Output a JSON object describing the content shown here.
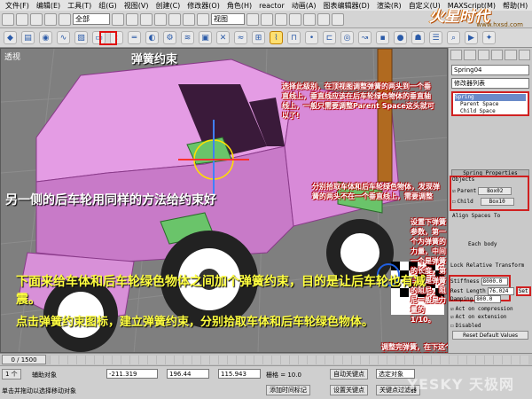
{
  "menubar": {
    "items": [
      "文件(F)",
      "编辑(E)",
      "工具(T)",
      "组(G)",
      "视图(V)",
      "创建(C)",
      "修改器(O)",
      "角色(H)",
      "reactor",
      "动画(A)",
      "图表编辑器(D)",
      "渲染(R)",
      "自定义(U)",
      "MAXScript(M)",
      "帮助(H)"
    ]
  },
  "toolbar1": {
    "selection_filter": "全部",
    "view_select": "视图"
  },
  "logo": {
    "main": "火星时代",
    "sub": "www.hxsd.com"
  },
  "viewport": {
    "label": "透视"
  },
  "annotations": {
    "spring_constraint": "弹簧约束",
    "select_spring": "选择此级别，在顶视图调整弹簧的两头到一个垂直线上，垂直线应该在后车轮绿色物体的垂直轴线上，一般只需要调整Parent Space这头就可以了!",
    "other_side": "另一侧的后车轮用同样的方法给约束好",
    "pick_objects": "分别拾取车体和后车轮绿色物体，发现弹簧的两头不在一个垂直线上，需要调整",
    "spring_params": "设置下弹簧参数，第一个为弹簧的力量，中间一个是弹簧的长度，第三个是弹簧的阻尼，阻尼一般是力量的1/10。",
    "instruction_1": "下面来给车体和后车轮绿色物体之间加个弹簧约束，目的是让后车轮也有减震。",
    "instruction_2": "点击弹簧约束图标，建立弹簧约束，分别拾取车体和后车轮绿色物体。",
    "after_adjust": "调整完弹簧，在下这个，重新设置下弹簧的长度，不然在动画中弹簧长度会改变了。"
  },
  "cmdpanel": {
    "object_name": "Spring04",
    "modifier_list": "修改器列表",
    "stack": [
      "Spring",
      "Parent Space",
      "Child Space"
    ],
    "spring_properties": "Spring Properties",
    "objects_label": "Objects",
    "parent_label": "Parent",
    "parent_btn": "Box02",
    "child_label": "Child",
    "child_btn": "Box10",
    "align_spaces": "Align Spaces To",
    "each_body": "Each body",
    "lock_relative": "Lock Relative Transform",
    "stiffness_label": "Stiffness",
    "stiffness_value": "8000.0",
    "rest_length_label": "Rest Length",
    "rest_length_value": "76.024",
    "set_label": "Set",
    "damping_label": "Damping",
    "damping_value": "800.0",
    "act_compression": "Act on compression",
    "act_extension": "Act on extension",
    "disabled": "Disabled",
    "reset_defaults": "Reset Default Values"
  },
  "timeline": {
    "slider": "0 / 1500"
  },
  "statusbar": {
    "selected": "1 个",
    "helper": "辅助对象",
    "prompt": "单击并拖动以选择移动对象",
    "x": "-211.319",
    "y": "196.44",
    "z": "115.943",
    "grid": "栅格 = 10.0",
    "auto_key": "自动关键点",
    "selected_object": "选定对象",
    "set_key": "设置关键点",
    "key_filters": "关键点过滤器",
    "add_time_tag": "添加时间标记"
  },
  "watermark": "YESKY 天极网"
}
